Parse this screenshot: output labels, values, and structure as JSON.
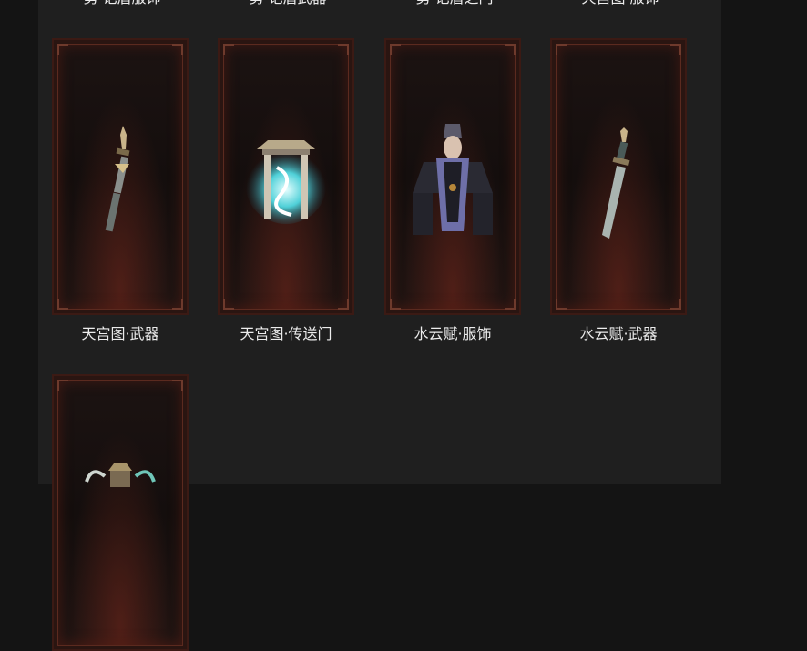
{
  "top_row_captions": [
    "勇·记盾服饰",
    "勇·记盾武器",
    "勇·记盾之门",
    "天宫图·服饰"
  ],
  "items": [
    {
      "caption": "天宫图·武器",
      "art": "sword-icon"
    },
    {
      "caption": "天宫图·传送门",
      "art": "portal-icon"
    },
    {
      "caption": "水云赋·服饰",
      "art": "costume-figure-icon"
    },
    {
      "caption": "水云赋·武器",
      "art": "blade-icon"
    },
    {
      "caption": "",
      "art": "dragon-portal-icon"
    }
  ]
}
